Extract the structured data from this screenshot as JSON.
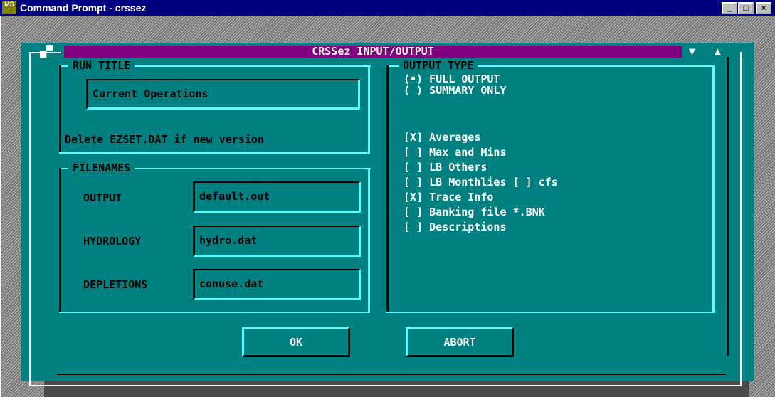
{
  "window": {
    "title": "Command Prompt - crssez",
    "icon_text": "MS",
    "controls": [
      "_",
      "□",
      "×"
    ]
  },
  "dialog": {
    "title": "CRSSez INPUT/OUTPUT",
    "left_control": "▄▀",
    "right_controls": [
      "▼",
      "▲"
    ]
  },
  "run_title": {
    "label": "RUN TITLE",
    "value": "Current Operations",
    "hint": "Delete EZSET.DAT if new version"
  },
  "filenames": {
    "label": "FILENAMES",
    "output": {
      "label": "OUTPUT",
      "value": "default.out"
    },
    "hydrology": {
      "label": "HYDROLOGY",
      "value": "hydro.dat"
    },
    "depletions": {
      "label": "DEPLETIONS",
      "value": "conuse.dat"
    }
  },
  "output_type": {
    "label": "OUTPUT TYPE",
    "radio": [
      {
        "mark": "(•)",
        "label": "FULL OUTPUT",
        "selected": true
      },
      {
        "mark": "( )",
        "label": "SUMMARY ONLY",
        "selected": false
      }
    ],
    "checks": [
      {
        "mark": "[X]",
        "label": "Averages",
        "checked": true
      },
      {
        "mark": "[ ]",
        "label": "Max and Mins",
        "checked": false
      },
      {
        "mark": "[ ]",
        "label": "LB Others",
        "checked": false
      },
      {
        "mark": "[ ]",
        "label": "LB Monthlies",
        "checked": false,
        "extra": "[ ] cfs"
      },
      {
        "mark": "[X]",
        "label": "Trace Info",
        "checked": true
      },
      {
        "mark": "[ ]",
        "label": "Banking file *.BNK",
        "checked": false
      },
      {
        "mark": "[ ]",
        "label": "Descriptions",
        "checked": false
      }
    ]
  },
  "buttons": {
    "ok": "OK",
    "abort": "ABORT"
  },
  "colors": {
    "titlebar": "#000080",
    "dialog": "#008080",
    "dialog_title": "#800080",
    "highlight": "#55ffff"
  }
}
